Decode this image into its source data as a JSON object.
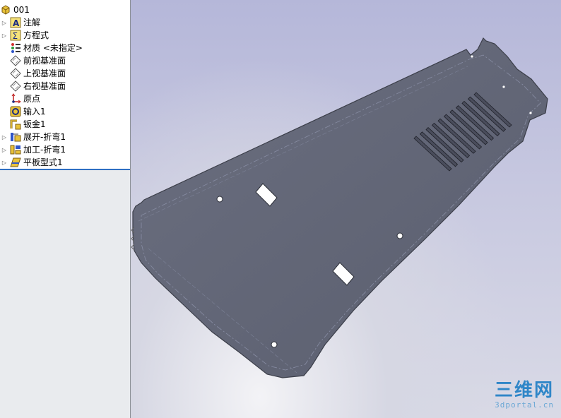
{
  "feature_tree": {
    "root": {
      "label": "001",
      "icon": "part-icon"
    },
    "items": [
      {
        "label": "注解",
        "icon": "annotations-icon",
        "expandable": true
      },
      {
        "label": "方程式",
        "icon": "equations-icon",
        "expandable": true
      },
      {
        "label": "材质 <未指定>",
        "icon": "material-icon",
        "expandable": false
      },
      {
        "label": "前视基准面",
        "icon": "plane-icon",
        "expandable": false
      },
      {
        "label": "上视基准面",
        "icon": "plane-icon",
        "expandable": false
      },
      {
        "label": "右视基准面",
        "icon": "plane-icon",
        "expandable": false
      },
      {
        "label": "原点",
        "icon": "origin-icon",
        "expandable": false
      },
      {
        "label": "输入1",
        "icon": "import-icon",
        "expandable": false
      },
      {
        "label": "钣金1",
        "icon": "sheet-metal-icon",
        "expandable": false
      },
      {
        "label": "展开-折弯1",
        "icon": "unfold-icon",
        "expandable": true
      },
      {
        "label": "加工-折弯1",
        "icon": "process-bend-icon",
        "expandable": true
      },
      {
        "label": "平板型式1",
        "icon": "flat-pattern-icon",
        "expandable": true
      }
    ]
  },
  "watermark": {
    "line1": "三维网",
    "line2": "3dportal.cn"
  },
  "colors": {
    "part_face": "#606474",
    "part_edge": "#3c3f4a",
    "selection_line": "#2f6fc3"
  }
}
